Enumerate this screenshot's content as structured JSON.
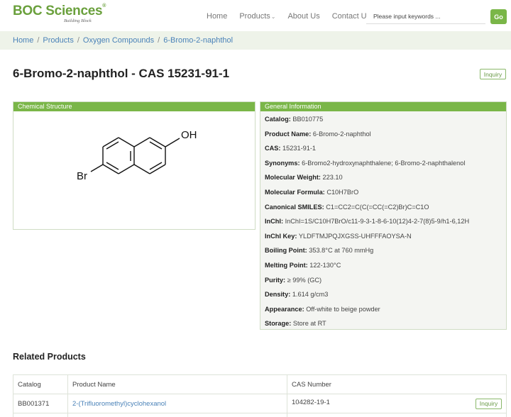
{
  "header": {
    "logo": "BOC Sciences",
    "logo_tagline": "Building Block",
    "nav": [
      {
        "label": "Home"
      },
      {
        "label": "Products",
        "has_dropdown": true
      },
      {
        "label": "About Us"
      },
      {
        "label": "Contact Us"
      }
    ],
    "search_placeholder": "Please input keywords ...",
    "go_label": "Go"
  },
  "breadcrumb": [
    "Home",
    "Products",
    "Oxygen Compounds",
    "6-Bromo-2-naphthol"
  ],
  "title": "6-Bromo-2-naphthol - CAS 15231-91-1",
  "inquiry_label": "Inquiry",
  "structure": {
    "header": "Chemical Structure",
    "atom_labels": {
      "oh": "OH",
      "br": "Br"
    }
  },
  "general_info": {
    "header": "General Information",
    "rows": [
      {
        "key": "Catalog:",
        "value": "BB010775"
      },
      {
        "key": "Product Name:",
        "value": "6-Bromo-2-naphthol"
      },
      {
        "key": "CAS:",
        "value": "15231-91-1"
      },
      {
        "key": "Synonyms:",
        "value": "6-Bromo2-hydroxynaphthalene; 6-Bromo-2-naphthalenol"
      },
      {
        "key": "Molecular Weight:",
        "value": "223.10"
      },
      {
        "key": "Molecular Formula:",
        "value": "C10H7BrO"
      },
      {
        "key": "Canonical SMILES:",
        "value": "C1=CC2=C(C(=CC(=C2)Br)C=C1O"
      },
      {
        "key": "InChI:",
        "value": "InChI=1S/C10H7BrO/c11-9-3-1-8-6-10(12)4-2-7(8)5-9/h1-6,12H"
      },
      {
        "key": "InChI Key:",
        "value": "YLDFTMJPQJXGSS-UHFFFAOYSA-N"
      },
      {
        "key": "Boiling Point:",
        "value": "353.8°C at 760 mmHg"
      },
      {
        "key": "Melting Point:",
        "value": "122-130°C"
      },
      {
        "key": "Purity:",
        "value": "≥ 99% (GC)"
      },
      {
        "key": "Density:",
        "value": "1.614 g/cm3"
      },
      {
        "key": "Appearance:",
        "value": "Off-white to beige powder"
      },
      {
        "key": "Storage:",
        "value": "Store at RT"
      }
    ]
  },
  "related": {
    "title": "Related Products",
    "columns": [
      "Catalog",
      "Product Name",
      "CAS Number"
    ],
    "rows": [
      {
        "catalog": "BB001371",
        "name": "2-(Trifluoromethyl)cyclohexanol",
        "cas": "104282-19-1",
        "action": "Inquiry"
      }
    ]
  },
  "colors": {
    "brand_green": "#7ab648",
    "link_blue": "#4a82b8"
  }
}
